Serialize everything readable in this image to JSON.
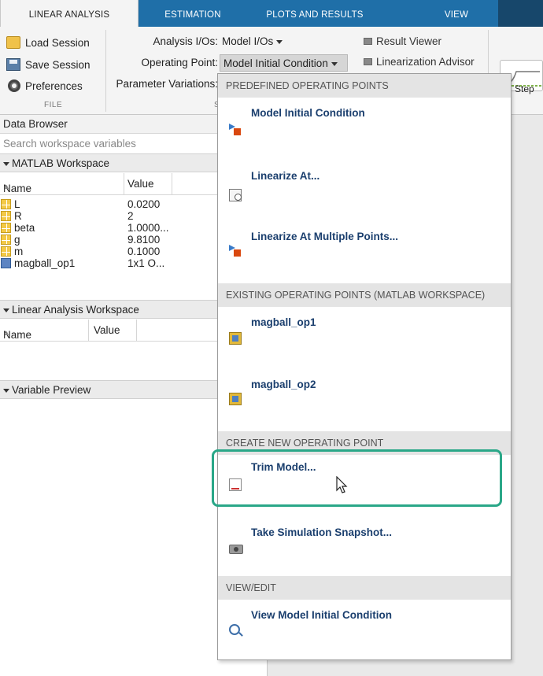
{
  "tabs": [
    {
      "label": "LINEAR ANALYSIS",
      "active": true
    },
    {
      "label": "ESTIMATION",
      "active": false
    },
    {
      "label": "PLOTS AND RESULTS",
      "active": false
    },
    {
      "label": "VIEW",
      "active": false
    }
  ],
  "toolstrip": {
    "file": {
      "load_session": "Load Session",
      "save_session": "Save Session",
      "preferences": "Preferences",
      "section_label": "FILE"
    },
    "analysis_ios_label": "Analysis I/Os:",
    "analysis_ios_value": "Model I/Os",
    "operating_point_label": "Operating Point:",
    "operating_point_value": "Model Initial Condition",
    "parameter_variations_label": "Parameter Variations:",
    "section_label_partial": "S",
    "result_viewer": "Result Viewer",
    "linearization_advisor": "Linearization Advisor",
    "step_label": "Step"
  },
  "left_panel": {
    "title": "Data Browser",
    "search_placeholder": "Search workspace variables",
    "matlab_workspace": {
      "header": "MATLAB Workspace",
      "col_name": "Name",
      "col_value": "Value",
      "rows": [
        {
          "name": "L",
          "value": "0.0200",
          "icon": "matrix-icon"
        },
        {
          "name": "R",
          "value": "2",
          "icon": "matrix-icon"
        },
        {
          "name": "beta",
          "value": "1.0000...",
          "icon": "matrix-icon"
        },
        {
          "name": "g",
          "value": "9.8100",
          "icon": "matrix-icon"
        },
        {
          "name": "m",
          "value": "0.1000",
          "icon": "matrix-icon"
        },
        {
          "name": "magball_op1",
          "value": "1x1 O...",
          "icon": "operating-point-icon"
        }
      ]
    },
    "linear_workspace": {
      "header": "Linear Analysis Workspace",
      "col_name": "Name",
      "col_value": "Value"
    },
    "variable_preview": {
      "header": "Variable Preview"
    }
  },
  "menu": {
    "sections": [
      {
        "header": "PREDEFINED OPERATING POINTS"
      },
      {
        "header": "EXISTING OPERATING POINTS (MATLAB WORKSPACE)"
      },
      {
        "header": "CREATE NEW OPERATING POINT"
      },
      {
        "header": "VIEW/EDIT"
      }
    ],
    "items": {
      "model_initial_condition": "Model Initial Condition",
      "linearize_at": "Linearize At...",
      "linearize_at_multiple": "Linearize At Multiple Points...",
      "magball_op1": "magball_op1",
      "magball_op2": "magball_op2",
      "trim_model": "Trim Model...",
      "take_snapshot": "Take Simulation Snapshot...",
      "view_model_ic": "View Model Initial Condition"
    }
  },
  "colors": {
    "tab_bar": "#1f6fa8",
    "menu_item_text": "#1b3f6e",
    "highlight": "#2aa788"
  }
}
